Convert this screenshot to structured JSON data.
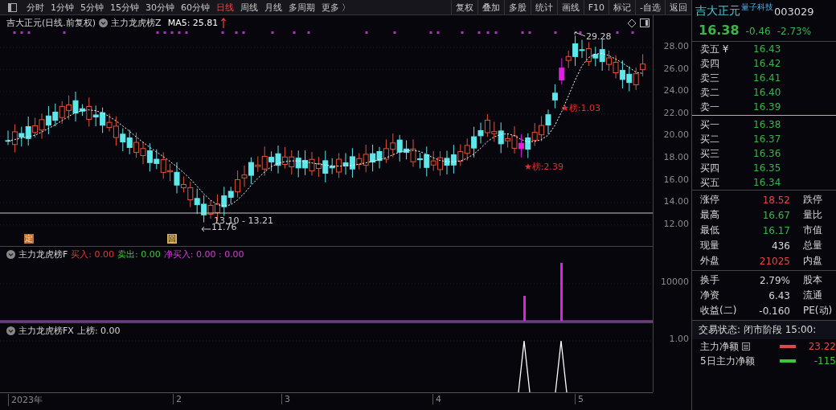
{
  "toolbar": {
    "periods": [
      {
        "label": "分时",
        "selected": false
      },
      {
        "label": "1分钟",
        "selected": false
      },
      {
        "label": "5分钟",
        "selected": false
      },
      {
        "label": "15分钟",
        "selected": false
      },
      {
        "label": "30分钟",
        "selected": false
      },
      {
        "label": "60分钟",
        "selected": false
      },
      {
        "label": "日线",
        "selected": true
      },
      {
        "label": "周线",
        "selected": false
      },
      {
        "label": "月线",
        "selected": false
      },
      {
        "label": "多周期",
        "selected": false
      },
      {
        "label": "更多 〉",
        "selected": false
      }
    ],
    "buttons": [
      "复权",
      "叠加",
      "多股",
      "统计",
      "画线",
      "F10",
      "标记",
      "-自选",
      "返回"
    ]
  },
  "chart": {
    "title": "吉大正元(日线.前复权)",
    "indicator": "主力龙虎榜Z",
    "ma": "MA5: 25.81",
    "yticks": [
      "28.00",
      "26.00",
      "24.00",
      "22.00",
      "20.00",
      "18.00",
      "16.00",
      "14.00",
      "12.00"
    ],
    "high_label": "29.28",
    "range_label": "13.10 - 13.21",
    "low_label": "11.76",
    "annotations": [
      {
        "text": "★榜:1.03"
      },
      {
        "text": "★榜:2.39"
      }
    ],
    "markers": [
      "定",
      "回"
    ]
  },
  "panel_f": {
    "title": "主力龙虎榜F",
    "values": [
      {
        "text": "买入: 0.00",
        "color": "#e03a3a"
      },
      {
        "text": "卖出: 0.00",
        "color": "#3ac83a"
      },
      {
        "text": "净买入: 0.00 : 0.00",
        "color": "#d040d0"
      }
    ],
    "ytick": "10000"
  },
  "panel_fx": {
    "title": "主力龙虎榜FX",
    "value": "上榜: 0.00",
    "ytick": "1.00"
  },
  "xaxis": [
    "2023年",
    "2",
    "3",
    "4",
    "5"
  ],
  "quote": {
    "name": "吉大正元",
    "concept": "量子科技",
    "code": "003029",
    "price": "16.38",
    "change": "-0.46",
    "percent": "-2.73%",
    "asks": [
      {
        "label": "卖五 ¥",
        "price": "16.43"
      },
      {
        "label": "卖四",
        "price": "16.42"
      },
      {
        "label": "卖三",
        "price": "16.41"
      },
      {
        "label": "卖二",
        "price": "16.40"
      },
      {
        "label": "卖一",
        "price": "16.39"
      }
    ],
    "bids": [
      {
        "label": "买一",
        "price": "16.38"
      },
      {
        "label": "买二",
        "price": "16.37"
      },
      {
        "label": "买三",
        "price": "16.36"
      },
      {
        "label": "买四",
        "price": "16.35"
      },
      {
        "label": "买五",
        "price": "16.34"
      }
    ],
    "stats": [
      {
        "label": "涨停",
        "value": "18.52",
        "color": "#e04848",
        "label2": "跌停"
      },
      {
        "label": "最高",
        "value": "16.67",
        "color": "#3cb44a",
        "label2": "量比"
      },
      {
        "label": "最低",
        "value": "16.17",
        "color": "#3cb44a",
        "label2": "市值"
      },
      {
        "label": "现量",
        "value": "436",
        "color": "#d8d8d8",
        "label2": "总量"
      },
      {
        "label": "外盘",
        "value": "21025",
        "color": "#e04848",
        "label2": "内盘"
      }
    ],
    "stats2": [
      {
        "label": "换手",
        "value": "2.79%",
        "label2": "股本"
      },
      {
        "label": "净资",
        "value": "6.43",
        "label2": "流通"
      },
      {
        "label": "收益(二)",
        "value": "-0.160",
        "label2": "PE(动)"
      }
    ],
    "status": "交易状态: 闭市阶段 15:00:",
    "flows": [
      {
        "label": "主力净额",
        "value": "23.22",
        "color": "#e04848"
      },
      {
        "label": "5日主力净额",
        "value": "-115",
        "color": "#3ac83a"
      }
    ]
  }
}
